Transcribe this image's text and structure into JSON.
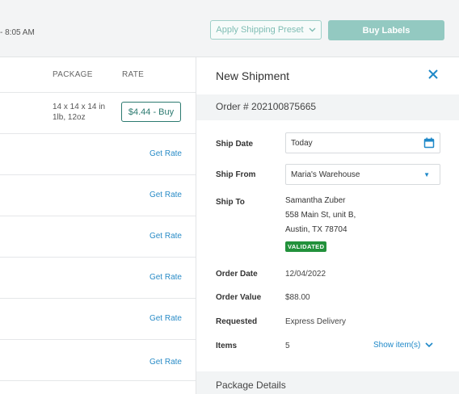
{
  "header": {
    "time_fragment": "- 8:05 AM",
    "apply_preset_label": "Apply Shipping Preset",
    "buy_labels_label": "Buy Labels"
  },
  "table": {
    "columns": {
      "package": "PACKAGE",
      "rate": "RATE"
    },
    "rows": [
      {
        "package_line1": "14 x 14 x 14 in",
        "package_line2": "1lb, 12oz",
        "rate": "$4.44 - Buy"
      },
      {
        "rate": "Get Rate"
      },
      {
        "rate": "Get Rate"
      },
      {
        "rate": "Get Rate"
      },
      {
        "rate": "Get Rate"
      },
      {
        "rate": "Get Rate"
      },
      {
        "rate": "Get Rate"
      }
    ]
  },
  "panel": {
    "title": "New Shipment",
    "order_number": "Order # 202100875665",
    "ship_date_label": "Ship Date",
    "ship_date_value": "Today",
    "ship_from_label": "Ship From",
    "ship_from_value": "Maria's Warehouse",
    "ship_to_label": "Ship To",
    "ship_to_name": "Samantha Zuber",
    "ship_to_street": "558 Main St, unit B,",
    "ship_to_city": "Austin, TX 78704",
    "validated_badge": "VALIDATED",
    "order_date_label": "Order Date",
    "order_date_value": "12/04/2022",
    "order_value_label": "Order Value",
    "order_value_value": "$88.00",
    "requested_label": "Requested",
    "requested_value": "Express Delivery",
    "items_label": "Items",
    "items_value": "5",
    "show_items_label": "Show item(s)",
    "package_details_title": "Package Details"
  },
  "colors": {
    "accent_teal": "#2c7a70",
    "link_blue": "#1e88c8",
    "validated_green": "#22913b"
  },
  "icons": [
    "chevron-down-icon",
    "close-icon",
    "calendar-icon",
    "caret-down-icon"
  ]
}
